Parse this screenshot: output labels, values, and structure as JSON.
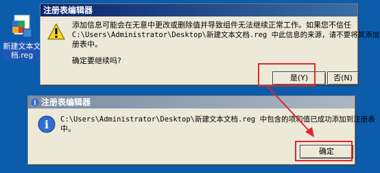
{
  "desktop": {
    "file_icon_label_line1": "新建文本文",
    "file_icon_label_line2": "档.reg"
  },
  "warning_dialog": {
    "title": "注册表编辑器",
    "message_line1": "添加信息可能会在无意中更改或删除值并导致组件无法继续正常工作。如果您不信任",
    "message_line2": "C:\\Users\\Administrator\\Desktop\\新建文本文档.reg 中此信息的来源，请不要将其添加到注",
    "message_line3": "册表中。",
    "question": "确定要继续吗?",
    "yes_button": "是(Y)",
    "no_button": "否(N)"
  },
  "info_dialog": {
    "title": "注册表编辑器",
    "message_line1": "C:\\Users\\Administrator\\Desktop\\新建文本文档.reg 中包含的项和值已成功添加到注册表",
    "message_line2": "中。",
    "ok_button": "确定"
  },
  "colors": {
    "annotation_red": "#e0252e",
    "desktop_blue": "#0b5cab"
  }
}
